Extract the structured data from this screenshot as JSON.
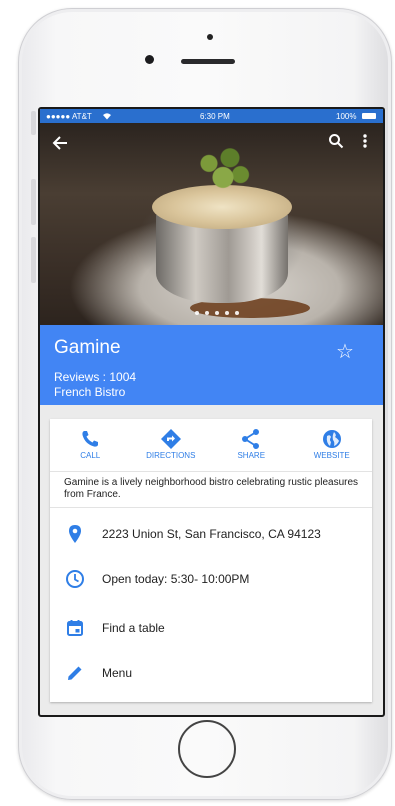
{
  "status_bar": {
    "carrier": "●●●●● AT&T",
    "time": "6:30 PM",
    "battery": "100%"
  },
  "toolbar": {
    "back_icon": "arrow-back-icon",
    "search_icon": "search-icon",
    "more_icon": "more-vert-icon"
  },
  "carousel": {
    "page_count": 5
  },
  "restaurant": {
    "name": "Gamine",
    "reviews": "Reviews : 1004",
    "category": "French Bistro"
  },
  "actions": [
    {
      "label": "CALL",
      "icon": "phone-icon"
    },
    {
      "label": "DIRECTIONS",
      "icon": "directions-icon"
    },
    {
      "label": "SHARE",
      "icon": "share-icon"
    },
    {
      "label": "WEBSITE",
      "icon": "globe-icon"
    }
  ],
  "description": "Gamine is a lively neighborhood bistro celebrating rustic pleasures from France.",
  "details": [
    {
      "text": "2223 Union St, San Francisco, CA 94123",
      "icon": "location-pin-icon"
    },
    {
      "text": "Open today: 5:30- 10:00PM",
      "icon": "clock-icon"
    },
    {
      "text": "Find a table",
      "icon": "calendar-icon"
    },
    {
      "text": "Menu",
      "icon": "pencil-icon"
    }
  ],
  "colors": {
    "accent": "#4285f4",
    "status_bar": "#2a6fce",
    "icon_blue": "#2f7ee6"
  }
}
